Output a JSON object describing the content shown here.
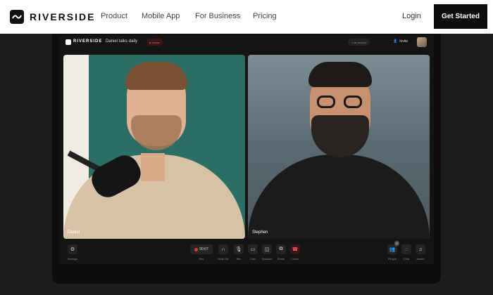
{
  "nav": {
    "brand": "RIVERSIDE",
    "links": [
      "Product",
      "Mobile App",
      "For Business",
      "Pricing"
    ],
    "login": "Login",
    "cta": "Get Started"
  },
  "app": {
    "brand": "RIVERSIDE",
    "title": "Daniel talks daily",
    "rec_badge": "● ••rec••",
    "download_pill": "+ ••• •••••••••",
    "invite": "Invite"
  },
  "tiles": [
    {
      "name": "Daniel"
    },
    {
      "name": "Stephen"
    }
  ],
  "controls": {
    "timer": "00:07",
    "left": {
      "icon": "gear-icon",
      "label": "Settings"
    },
    "center": [
      {
        "icon": "record-icon",
        "label": "Rec"
      },
      {
        "icon": "headphones-icon",
        "label": "Mute Me"
      },
      {
        "icon": "mic-icon",
        "label": "Mic"
      },
      {
        "icon": "camera-icon",
        "label": "Cam"
      },
      {
        "icon": "speaker-icon",
        "label": "Speaker"
      },
      {
        "icon": "share-icon",
        "label": "Share"
      },
      {
        "icon": "end-call-icon",
        "label": "Leave"
      }
    ],
    "right": [
      {
        "icon": "people-icon",
        "label": "People"
      },
      {
        "icon": "chat-icon",
        "label": "Chat"
      },
      {
        "icon": "media-icon",
        "label": "Media"
      }
    ],
    "people_count": "2"
  },
  "colors": {
    "cta_bg": "#0b0b0b",
    "end_call": "#ff5a5a",
    "rec_dot": "#e53935"
  }
}
